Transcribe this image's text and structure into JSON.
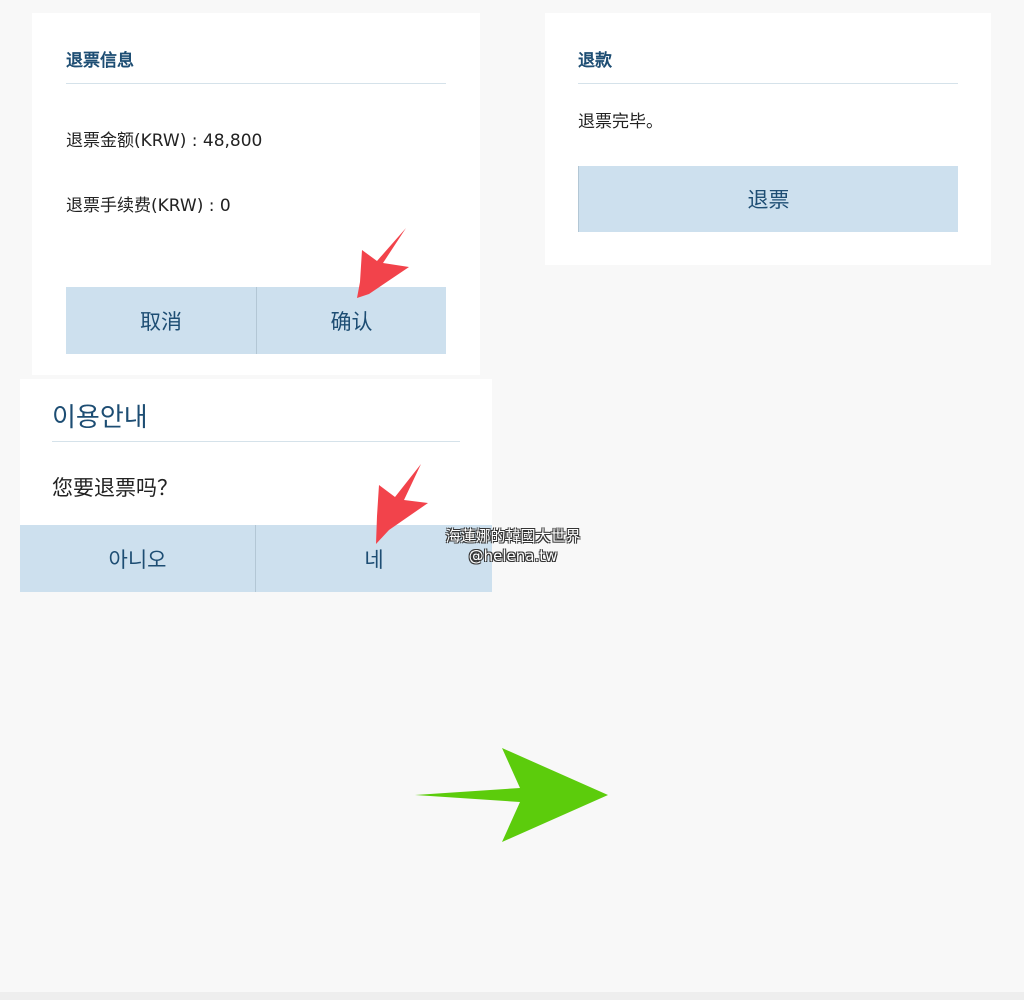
{
  "refund_info_card": {
    "title": "退票信息",
    "amount_line": "退票金额(KRW) : 48,800",
    "fee_line": "退票手续费(KRW) : 0",
    "cancel_label": "取消",
    "confirm_label": "确认"
  },
  "refund_done_card": {
    "title": "退款",
    "message": "退票完毕。",
    "refund_label": "退票"
  },
  "notice_dialog": {
    "title": "이용안내",
    "question": "您要退票吗？",
    "no_label": "아니오",
    "yes_label": "네"
  },
  "watermark": {
    "line1": "海蓮娜的韓國大世界",
    "line2": "@helena.tw"
  },
  "colors": {
    "button_bg": "#cde0ee",
    "title_color": "#1d4d73",
    "red_arrow": "#f2434b",
    "green_arrow": "#5ccc0c"
  },
  "icons": {
    "red_arrow": "arrow-down-left-icon",
    "green_arrow": "arrow-right-icon"
  }
}
